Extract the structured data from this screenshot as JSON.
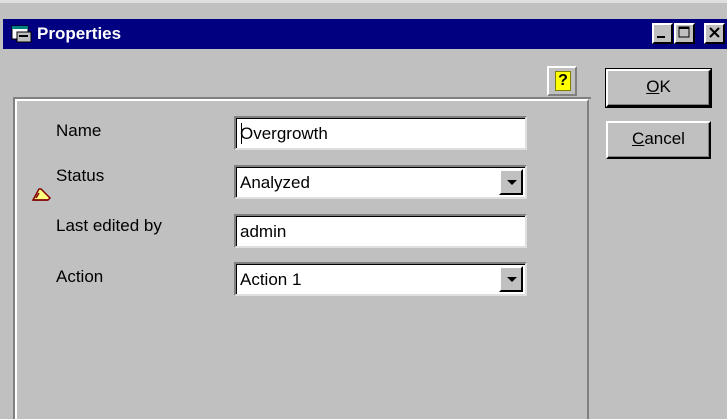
{
  "window": {
    "title": "Properties",
    "minimize_glyph": "_",
    "maximize_glyph": "□",
    "close_glyph": "✕"
  },
  "help_button": {
    "label": "?",
    "icon": "help-question-icon"
  },
  "fields": {
    "name": {
      "label": "Name",
      "value": "Overgrowth"
    },
    "status": {
      "label": "Status",
      "value": "Analyzed",
      "icon": "edit-pencil-icon"
    },
    "last_edited_by": {
      "label": "Last edited by",
      "value": "admin"
    },
    "action": {
      "label": "Action",
      "value": "Action 1"
    }
  },
  "buttons": {
    "ok": {
      "accel": "O",
      "rest": "K"
    },
    "cancel": {
      "accel": "C",
      "rest": "ancel"
    }
  },
  "colors": {
    "title_bar": "#000080",
    "face": "#c0c0c0",
    "field_bg": "#ffffff"
  }
}
